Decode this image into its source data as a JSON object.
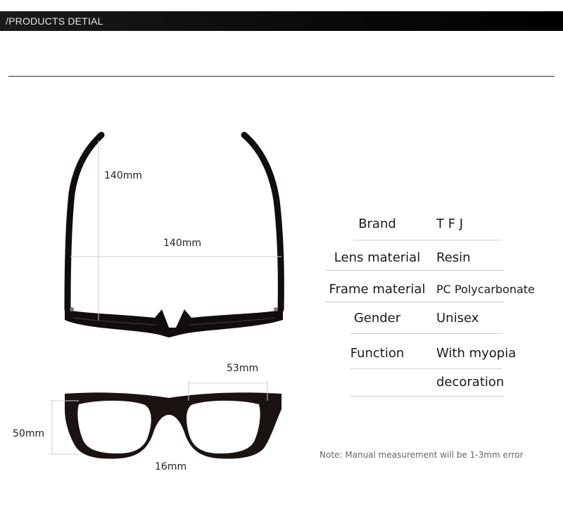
{
  "header": {
    "title": "/PRODUCTS DETIAL"
  },
  "dimensions": {
    "temple_length": "140mm",
    "frame_width": "140mm",
    "lens_width": "53mm",
    "lens_height": "50mm",
    "bridge_width": "16mm"
  },
  "specs": [
    {
      "label": "Brand",
      "value": "T F J"
    },
    {
      "label": "Lens material",
      "value": "Resin"
    },
    {
      "label": "Frame material",
      "value": "PC Polycarbonate"
    },
    {
      "label": "Gender",
      "value": "Unisex"
    },
    {
      "label": "Function",
      "value": "With myopia"
    },
    {
      "label": "",
      "value": "decoration"
    }
  ],
  "note": "Note: Manual measurement will be 1-3mm error",
  "colors": {
    "frame": "#1b1212",
    "header": "#000000",
    "divider": "#333333"
  }
}
